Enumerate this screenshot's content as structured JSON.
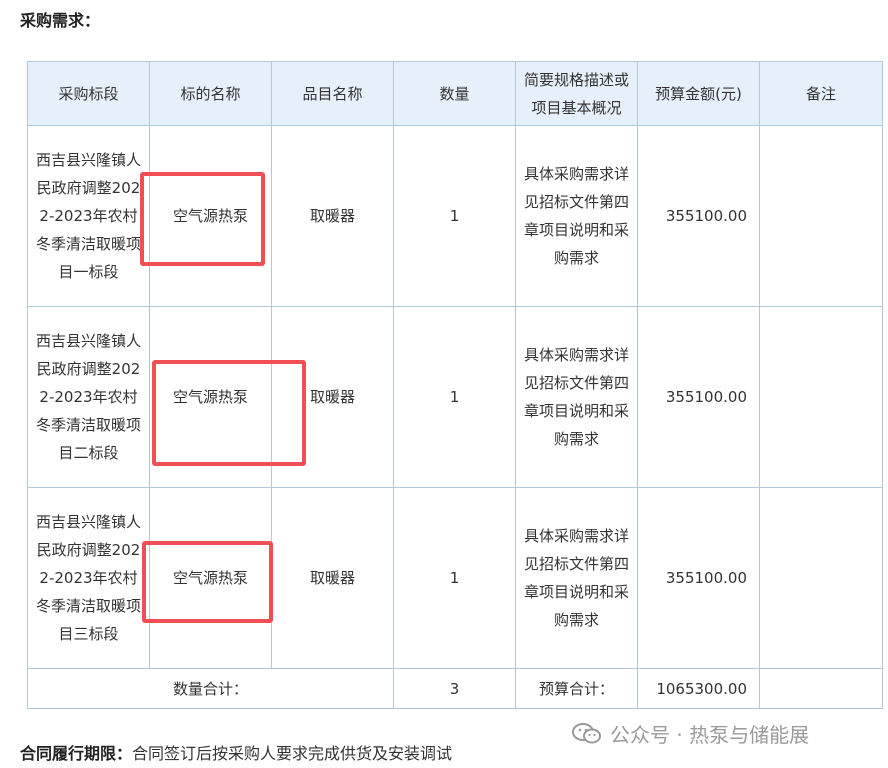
{
  "heading": "采购需求：",
  "table": {
    "headers": [
      "采购标段",
      "标的名称",
      "品目名称",
      "数量",
      "简要规格描述或项目基本概况",
      "预算金额(元)",
      "备注"
    ],
    "rows": [
      {
        "section": "西吉县兴隆镇人民政府调整2022-2023年农村冬季清洁取暖项目一标段",
        "target": "空气源热泵",
        "category": "取暖器",
        "quantity": "1",
        "spec": "具体采购需求详见招标文件第四章项目说明和采购需求",
        "budget": "355100.00",
        "remark": ""
      },
      {
        "section": "西吉县兴隆镇人民政府调整2022-2023年农村冬季清洁取暖项目二标段",
        "target": "空气源热泵",
        "category": "取暖器",
        "quantity": "1",
        "spec": "具体采购需求详见招标文件第四章项目说明和采购需求",
        "budget": "355100.00",
        "remark": ""
      },
      {
        "section": "西吉县兴隆镇人民政府调整2022-2023年农村冬季清洁取暖项目三标段",
        "target": "空气源热泵",
        "category": "取暖器",
        "quantity": "1",
        "spec": "具体采购需求详见招标文件第四章项目说明和采购需求",
        "budget": "355100.00",
        "remark": ""
      }
    ],
    "totals": {
      "quantity_label": "数量合计：",
      "quantity_value": "3",
      "budget_label": "预算合计：",
      "budget_value": "1065300.00"
    }
  },
  "footer": {
    "label": "合同履行期限：",
    "text": "合同签订后按采购人要求完成供货及安装调试"
  },
  "watermark": {
    "text": "公众号 · 热泵与储能展",
    "icon": "wechat-icon"
  },
  "colors": {
    "header_bg": "#e6f0fa",
    "border": "#b3c8dc",
    "highlight": "#ef4f55"
  }
}
